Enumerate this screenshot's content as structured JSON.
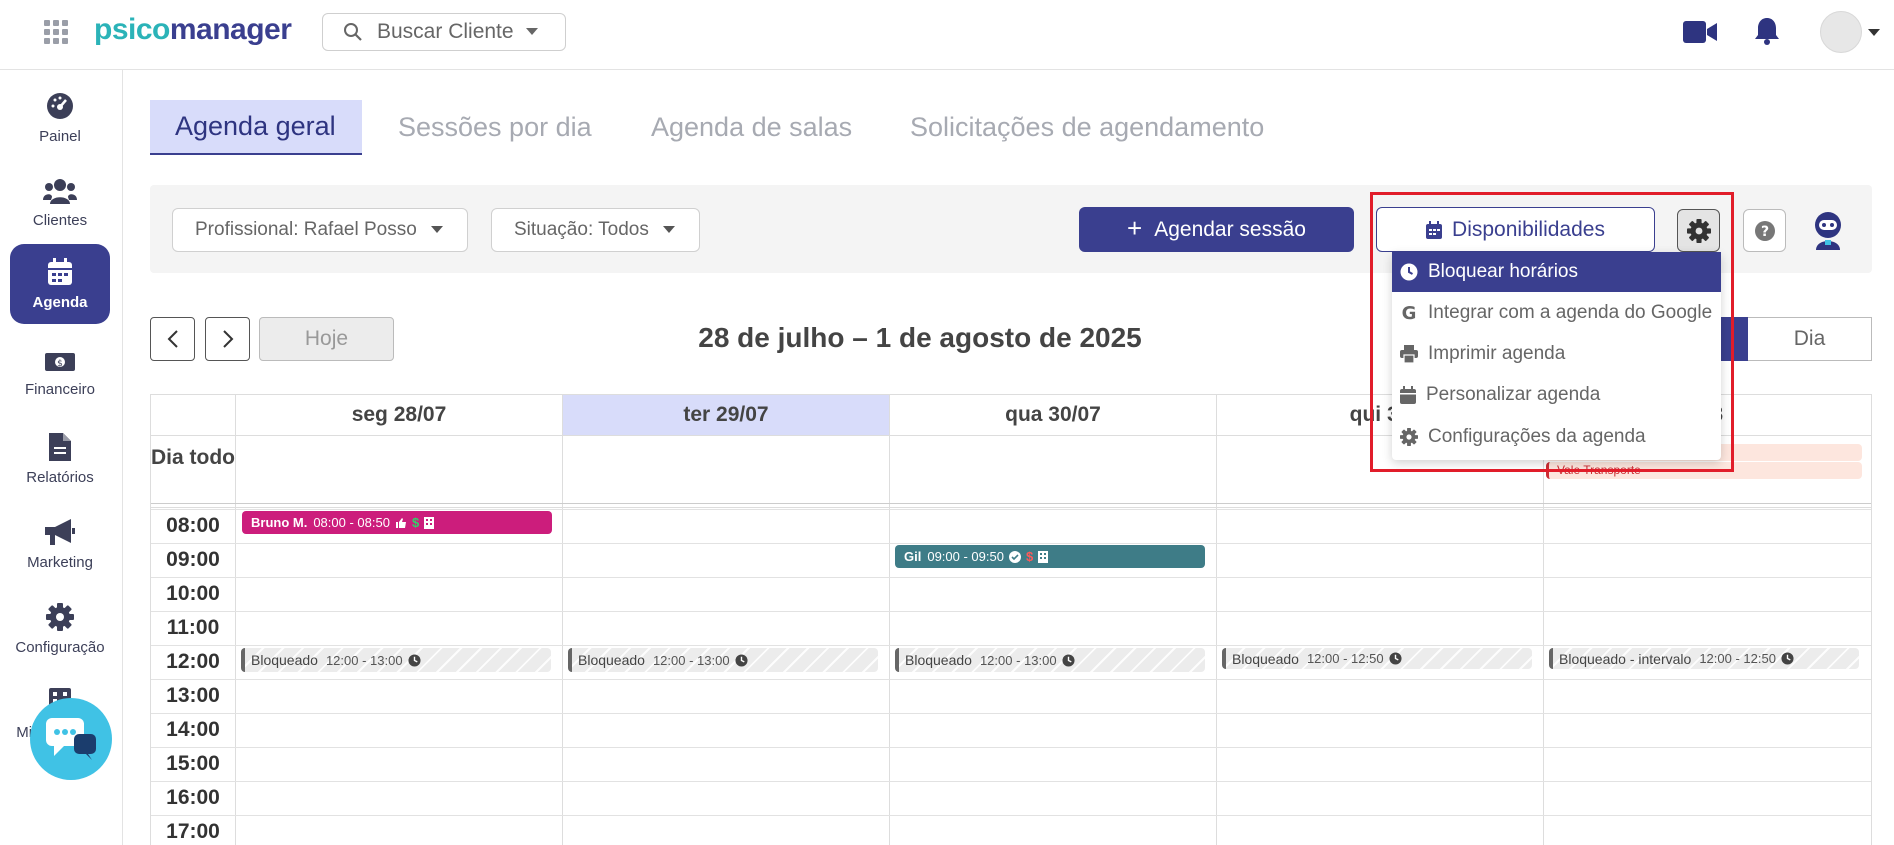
{
  "header": {
    "logo_part1": "psico",
    "logo_part2": "manager",
    "search_placeholder": "Buscar Cliente",
    "icons": [
      "apps-icon",
      "search-icon",
      "video-icon",
      "bell-icon",
      "avatar",
      "chevron-down-icon"
    ]
  },
  "sidebar": {
    "items": [
      {
        "label": "Painel",
        "icon": "dashboard-icon"
      },
      {
        "label": "Clientes",
        "icon": "users-icon"
      },
      {
        "label": "Agenda",
        "icon": "calendar-icon",
        "active": true
      },
      {
        "label": "Financeiro",
        "icon": "money-icon"
      },
      {
        "label": "Relatórios",
        "icon": "document-icon"
      },
      {
        "label": "Marketing",
        "icon": "megaphone-icon"
      },
      {
        "label": "Configuração",
        "icon": "gear-icon"
      },
      {
        "label": "Minha clínica",
        "icon": "building-icon"
      }
    ]
  },
  "tabs": [
    {
      "label": "Agenda geral",
      "active": true
    },
    {
      "label": "Sessões por dia"
    },
    {
      "label": "Agenda de salas"
    },
    {
      "label": "Solicitações de agendamento"
    }
  ],
  "toolbar": {
    "professional_filter": "Profissional: Rafael Posso",
    "status_filter": "Situação: Todos",
    "schedule_button": "Agendar sessão",
    "availability_button": "Disponibilidades"
  },
  "menu": {
    "items": [
      {
        "label": "Bloquear horários",
        "icon": "clock-icon",
        "active": true
      },
      {
        "label": "Integrar com a agenda do Google",
        "icon": "google-icon"
      },
      {
        "label": "Imprimir agenda",
        "icon": "printer-icon"
      },
      {
        "label": "Personalizar agenda",
        "icon": "calendar-icon"
      },
      {
        "label": "Configurações da agenda",
        "icon": "gear-icon"
      }
    ]
  },
  "calendar": {
    "range_title": "28 de julho – 1 de agosto de 2025",
    "today_button": "Hoje",
    "view_day": "Dia",
    "allday_label": "Dia todo",
    "days": [
      "seg 28/07",
      "ter 29/07",
      "qua 30/07",
      "qui 31",
      "/08"
    ],
    "hours": [
      "08:00",
      "09:00",
      "10:00",
      "11:00",
      "12:00",
      "13:00",
      "14:00",
      "15:00",
      "16:00",
      "17:00"
    ],
    "allday_event": "Vale Transporte",
    "events": [
      {
        "name": "Bruno M.",
        "time": "08:00 - 08:50",
        "color": "#cc1d7c"
      },
      {
        "name": "Gil",
        "time": "09:00 - 09:50",
        "color": "#3e7c87"
      }
    ],
    "blocked": [
      {
        "label": "Bloqueado",
        "time": "12:00 - 13:00"
      },
      {
        "label": "Bloqueado",
        "time": "12:00 - 13:00"
      },
      {
        "label": "Bloqueado",
        "time": "12:00 - 13:00"
      },
      {
        "label": "Bloqueado",
        "time": "12:00 - 12:50"
      },
      {
        "label": "Bloqueado - intervalo",
        "time": "12:00 - 12:50"
      }
    ]
  },
  "colors": {
    "primary": "#3a3f8f",
    "tab_active_bg": "#d8dcfa",
    "logo_teal": "#2bb3b8",
    "highlight": "#e11d2a",
    "chat": "#40c2e5"
  }
}
